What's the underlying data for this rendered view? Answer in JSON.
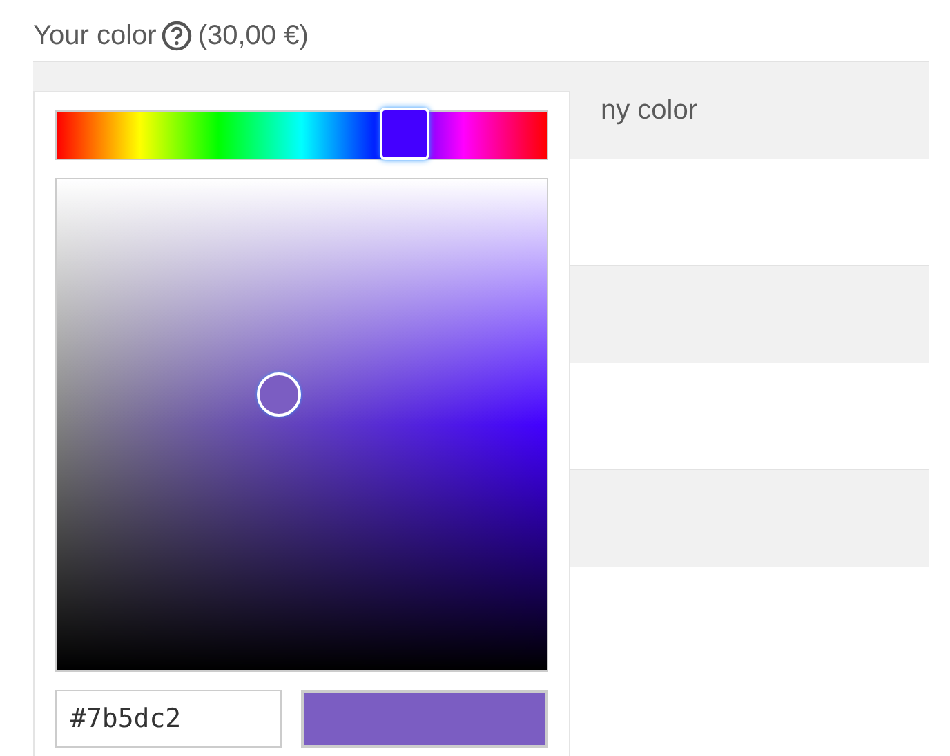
{
  "field": {
    "label": "Your color",
    "price": "(30,00 €)"
  },
  "option_rows": [
    {
      "label": "ny color"
    }
  ],
  "picker": {
    "hue_slider": {
      "level": 0.71,
      "color": "#4400ff"
    },
    "hex_input": {
      "value": "#7b5dc2"
    },
    "swatch": {
      "color": "#7b5dc2"
    }
  }
}
